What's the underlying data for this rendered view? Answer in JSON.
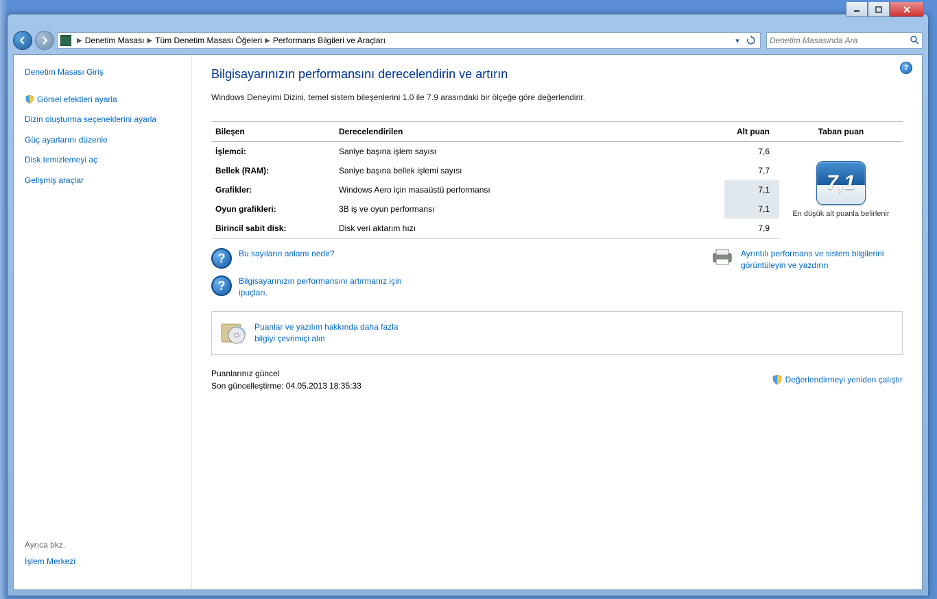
{
  "breadcrumb": {
    "items": [
      "Denetim Masası",
      "Tüm Denetim Masası Öğeleri",
      "Performans Bilgileri ve Araçları"
    ]
  },
  "search": {
    "placeholder": "Denetim Masasında Ara"
  },
  "sidebar": {
    "home": "Denetim Masası Giriş",
    "items": [
      "Görsel efektleri ayarla",
      "Dizin oluşturma seçeneklerini ayarla",
      "Güç ayarlarını düzenle",
      "Disk temizlemeyi aç",
      "Gelişmiş araçlar"
    ],
    "see_also_label": "Ayrıca bkz.",
    "see_also_link": "İşlem Merkezi"
  },
  "main": {
    "heading": "Bilgisayarınızın performansını derecelendirin ve artırın",
    "description": "Windows Deneyimi Dizini, temel sistem bileşenlerini 1.0 ile 7.9 arasındaki bir ölçeğe göre değerlendirir.",
    "table": {
      "headers": {
        "component": "Bileşen",
        "rated": "Derecelendirilen",
        "subscore": "Alt puan",
        "base": "Taban puan"
      },
      "rows": [
        {
          "name": "İşlemci:",
          "rated": "Saniye başına işlem sayısı",
          "score": "7,6",
          "highlight": false
        },
        {
          "name": "Bellek (RAM):",
          "rated": "Saniye başına bellek işlemi sayısı",
          "score": "7,7",
          "highlight": false
        },
        {
          "name": "Grafikler:",
          "rated": "Windows Aero için masaüstü performansı",
          "score": "7,1",
          "highlight": true
        },
        {
          "name": "Oyun grafikleri:",
          "rated": "3B iş ve oyun performansı",
          "score": "7,1",
          "highlight": true
        },
        {
          "name": "Birincil sabit disk:",
          "rated": "Disk veri aktarım hızı",
          "score": "7,9",
          "highlight": false
        }
      ],
      "base_score": "7,1",
      "base_note": "En düşük alt puanla belirlenir"
    },
    "links": {
      "meaning": "Bu sayıların anlamı nedir?",
      "tips": "Bilgisayarınızın performansını artırmanız için ipuçları.",
      "print": "Ayrıntılı performans ve sistem bilgilerini görüntüleyin ve yazdırın",
      "online": "Puanlar ve yazılım hakkında daha fazla bilgiyi çevrimiçi alın"
    },
    "status": {
      "current": "Puanlarınız güncel",
      "updated_label": "Son güncelleştirme:",
      "updated_value": "04.05.2013 18:35:33",
      "rerun": "Değerlendirmeyi yeniden çalıştır"
    }
  }
}
